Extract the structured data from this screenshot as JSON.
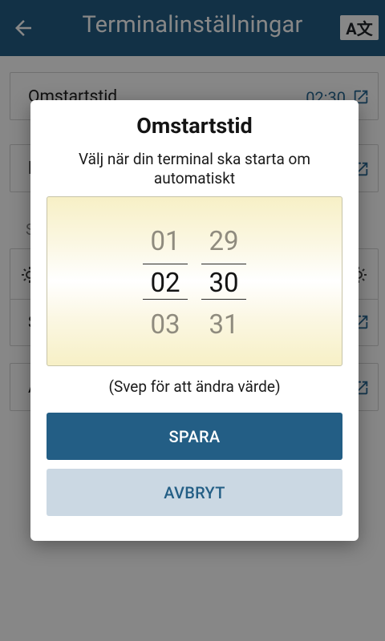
{
  "appbar": {
    "title": "Terminalinställningar",
    "back_icon": "arrow-left",
    "lang_icon": "translate",
    "lang_label": "A文"
  },
  "list": {
    "row1": {
      "label": "Omstartstid",
      "value": "02:30",
      "icon": "open-external"
    },
    "row2": {
      "label": "l",
      "icon": "open-external"
    },
    "section": {
      "label": "S"
    },
    "row3": {
      "icon_left": "sun",
      "icon_right": "sun"
    },
    "row4": {
      "label": "S",
      "icon": "open-external"
    },
    "row5": {
      "label": "A",
      "icon": "open-external"
    }
  },
  "dialog": {
    "title": "Omstartstid",
    "description": "Välj när din terminal ska starta om automatiskt",
    "picker": {
      "hours": {
        "prev": "01",
        "current": "02",
        "next": "03"
      },
      "minutes": {
        "prev": "29",
        "current": "30",
        "next": "31"
      }
    },
    "hint": "(Svep för att ändra värde)",
    "save_label": "SPARA",
    "cancel_label": "AVBRYT"
  },
  "colors": {
    "primary": "#235e85",
    "secondary_button": "#cbd8e3",
    "picker_highlight": "#f7f0c6"
  }
}
